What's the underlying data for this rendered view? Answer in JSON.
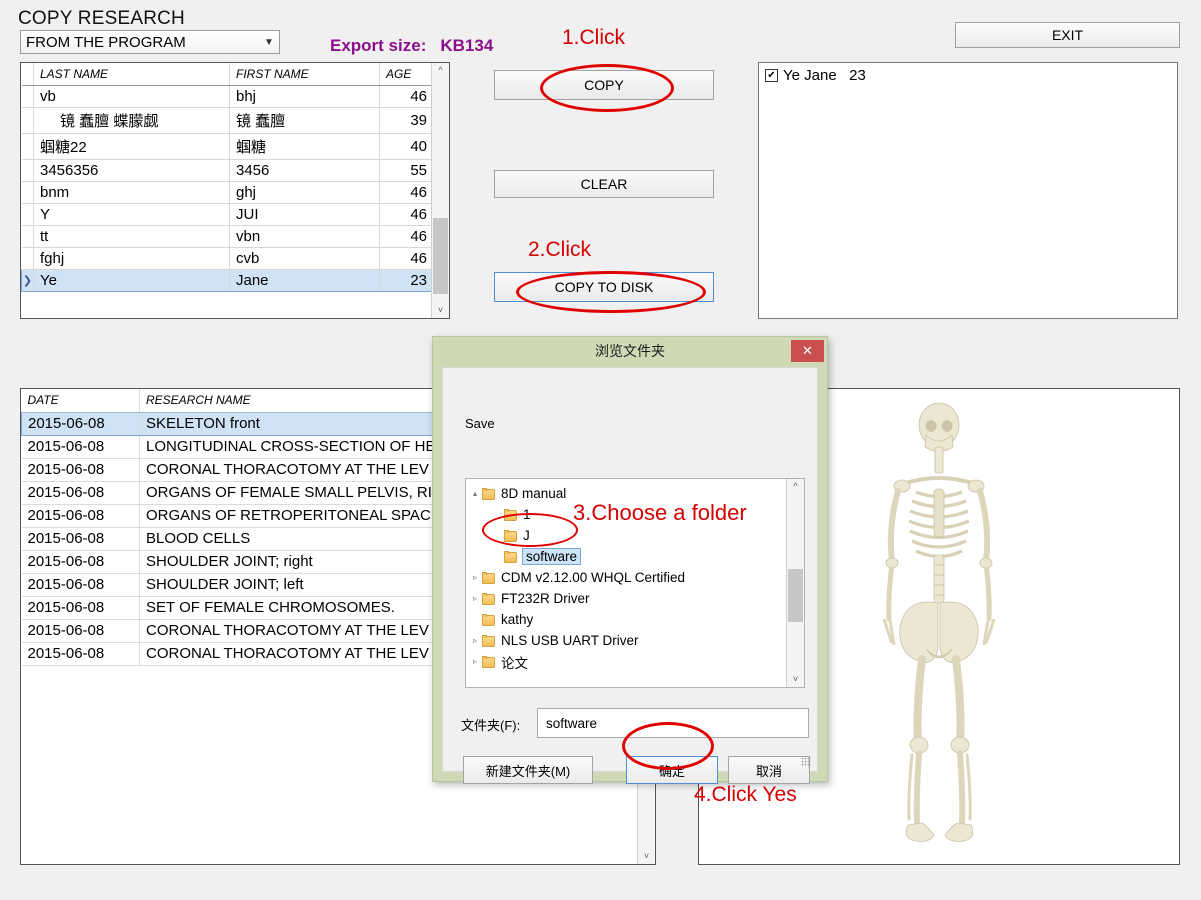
{
  "app": {
    "title": "COPY RESEARCH",
    "source_select": {
      "value": "FROM THE PROGRAM",
      "chevron": "chevron-down-icon"
    },
    "export_size": {
      "label": "Export size:",
      "value": "KB134",
      "color": "#8B0F8B"
    },
    "exit_button": "EXIT"
  },
  "people_grid": {
    "columns": [
      "LAST NAME",
      "FIRST NAME",
      "AGE"
    ],
    "rows": [
      {
        "mark": "",
        "last": "vb",
        "first": "bhj",
        "age": "46",
        "selected": false,
        "indent": false
      },
      {
        "mark": "",
        "last": "镜 蠢膻 蝶朦觑",
        "first": "镜 蠢膻",
        "age": "39",
        "selected": false,
        "indent": true
      },
      {
        "mark": "",
        "last": "蝈糖22",
        "first": "蝈糖",
        "age": "40",
        "selected": false,
        "indent": false
      },
      {
        "mark": "",
        "last": "3456356",
        "first": "3456",
        "age": "55",
        "selected": false,
        "indent": false
      },
      {
        "mark": "",
        "last": "bnm",
        "first": "ghj",
        "age": "46",
        "selected": false,
        "indent": false
      },
      {
        "mark": "",
        "last": "Y",
        "first": "JUI",
        "age": "46",
        "selected": false,
        "indent": false
      },
      {
        "mark": "",
        "last": "tt",
        "first": "vbn",
        "age": "46",
        "selected": false,
        "indent": false
      },
      {
        "mark": "",
        "last": "fghj",
        "first": "cvb",
        "age": "46",
        "selected": false,
        "indent": false
      },
      {
        "mark": "❯",
        "last": "Ye",
        "first": "Jane",
        "age": "23",
        "selected": true,
        "indent": false
      }
    ]
  },
  "actions": {
    "copy": "COPY",
    "clear": "CLEAR",
    "copy_to_disk": "COPY TO DISK"
  },
  "annotations": {
    "step1": "1.Click",
    "step2": "2.Click",
    "step3": "3.Choose a folder",
    "step4": "4.Click Yes",
    "color": "#d40000"
  },
  "selected_list": {
    "items": [
      {
        "checked": true,
        "check_glyph": "✔",
        "text": "Ye Jane   23"
      }
    ]
  },
  "research_grid": {
    "columns": [
      "DATE",
      "RESEARCH NAME"
    ],
    "rows": [
      {
        "date": "2015-06-08",
        "name": "SKELETON front",
        "selected": true
      },
      {
        "date": "2015-06-08",
        "name": "LONGITUDINAL CROSS-SECTION OF HE",
        "selected": false
      },
      {
        "date": "2015-06-08",
        "name": "CORONAL THORACOTOMY AT THE LEV",
        "selected": false
      },
      {
        "date": "2015-06-08",
        "name": "ORGANS OF FEMALE SMALL PELVIS, RIG",
        "selected": false
      },
      {
        "date": "2015-06-08",
        "name": "ORGANS OF RETROPERITONEAL SPACE",
        "selected": false
      },
      {
        "date": "2015-06-08",
        "name": "BLOOD  CELLS",
        "selected": false
      },
      {
        "date": "2015-06-08",
        "name": "SHOULDER JOINT; right",
        "selected": false
      },
      {
        "date": "2015-06-08",
        "name": "SHOULDER JOINT; left",
        "selected": false
      },
      {
        "date": "2015-06-08",
        "name": "SET OF FEMALE CHROMOSOMES.",
        "selected": false
      },
      {
        "date": "2015-06-08",
        "name": "CORONAL THORACOTOMY AT THE LEV",
        "selected": false
      },
      {
        "date": "2015-06-08",
        "name": "CORONAL THORACOTOMY AT THE LEV",
        "selected": false
      }
    ]
  },
  "preview": {
    "image": "human-skeleton-front-view"
  },
  "dialog": {
    "title": "浏览文件夹",
    "close_glyph": "✕",
    "save_label": "Save",
    "tree": [
      {
        "label": "8D manual",
        "depth": 0,
        "twisty": "▴",
        "selected": false
      },
      {
        "label": "1",
        "depth": 1,
        "twisty": "",
        "selected": false
      },
      {
        "label": "J",
        "depth": 1,
        "twisty": "",
        "selected": false
      },
      {
        "label": "software",
        "depth": 1,
        "twisty": "",
        "selected": true
      },
      {
        "label": "CDM v2.12.00 WHQL Certified",
        "depth": 0,
        "twisty": "▹",
        "selected": false
      },
      {
        "label": "FT232R Driver",
        "depth": 0,
        "twisty": "▹",
        "selected": false
      },
      {
        "label": "kathy",
        "depth": 0,
        "twisty": "",
        "selected": false
      },
      {
        "label": "NLS USB UART Driver",
        "depth": 0,
        "twisty": "▹",
        "selected": false
      },
      {
        "label": "论文",
        "depth": 0,
        "twisty": "▹",
        "selected": false
      }
    ],
    "folder_field_label": "文件夹(F):",
    "folder_field_value": "software",
    "new_folder_button": "新建文件夹(M)",
    "ok_button": "确定",
    "cancel_button": "取消"
  }
}
